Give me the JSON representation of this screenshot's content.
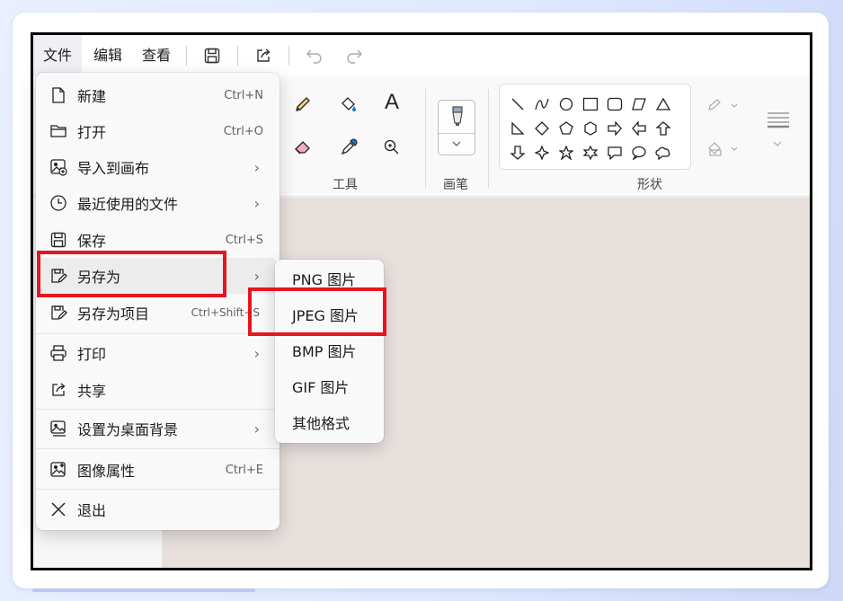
{
  "menubar": {
    "file": "文件",
    "edit": "编辑",
    "view": "查看",
    "icons": [
      "save-icon",
      "share-icon",
      "undo-icon",
      "redo-icon"
    ]
  },
  "ribbon": {
    "tools_label": "工具",
    "brushes_label": "画笔",
    "shapes_label": "形状"
  },
  "file_menu": {
    "items": [
      {
        "label": "新建",
        "shortcut": "Ctrl+N",
        "icon": "new-file-icon"
      },
      {
        "label": "打开",
        "shortcut": "Ctrl+O",
        "icon": "folder-icon"
      },
      {
        "label": "导入到画布",
        "arrow": "›",
        "icon": "import-image-icon"
      },
      {
        "label": "最近使用的文件",
        "arrow": "›",
        "icon": "clock-icon"
      },
      {
        "label": "保存",
        "shortcut": "Ctrl+S",
        "icon": "save-icon"
      },
      {
        "label": "另存为",
        "arrow": "›",
        "icon": "save-as-icon"
      },
      {
        "label": "另存为项目",
        "shortcut": "Ctrl+Shift+S",
        "icon": "save-project-icon"
      },
      {
        "label": "打印",
        "arrow": "›",
        "icon": "printer-icon"
      },
      {
        "label": "共享",
        "icon": "share-icon"
      },
      {
        "label": "设置为桌面背景",
        "arrow": "›",
        "icon": "desktop-background-icon"
      },
      {
        "label": "图像属性",
        "shortcut": "Ctrl+E",
        "icon": "image-properties-icon"
      },
      {
        "label": "退出",
        "icon": "close-icon"
      }
    ]
  },
  "save_as_submenu": {
    "items": [
      "PNG 图片",
      "JPEG 图片",
      "BMP 图片",
      "GIF 图片",
      "其他格式"
    ]
  },
  "colors": {
    "highlight": "#e5161d",
    "canvas": "#e8e0dd"
  }
}
